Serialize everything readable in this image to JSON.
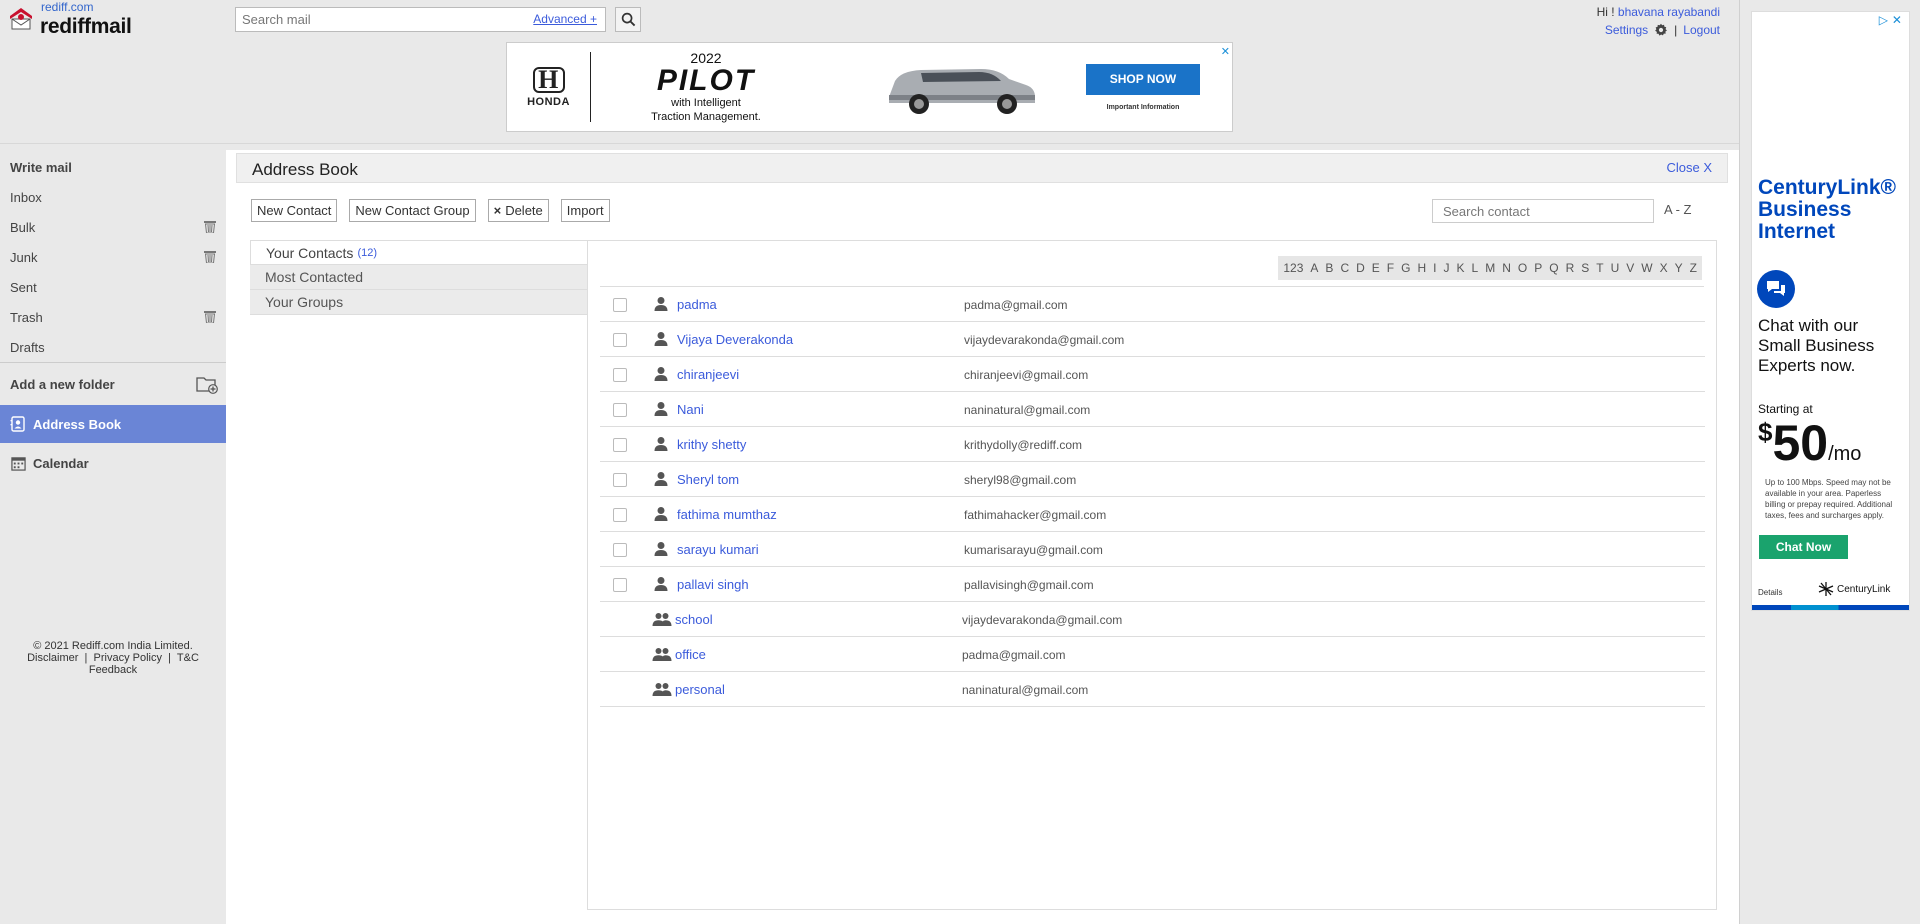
{
  "header": {
    "site_link": "rediff.com",
    "logo_text": "rediffmail",
    "search_placeholder": "Search mail",
    "advanced_label": "Advanced +",
    "greeting": "Hi !",
    "user_name": "bhavana rayabandi",
    "settings_label": "Settings",
    "logout_label": "Logout"
  },
  "ad_banner": {
    "brand": "HONDA",
    "year": "2022",
    "model": "PILOT",
    "tagline_1": "with Intelligent",
    "tagline_2": "Traction Management.",
    "cta": "SHOP NOW",
    "info": "Important Information"
  },
  "side_ad": {
    "brand_line_1": "CenturyLink®",
    "brand_line_2": "Business",
    "brand_line_3": "Internet",
    "chat_text": "Chat with our Small Business Experts now.",
    "starting": "Starting at",
    "dollar": "$",
    "price": "50",
    "per": "/mo",
    "fine_print": "Up to 100 Mbps. Speed may not be available in your area. Paperless billing or prepay required. Additional taxes, fees and surcharges apply.",
    "cta": "Chat Now",
    "details": "Details",
    "logo_text": "CenturyLink"
  },
  "sidebar": {
    "write_mail": "Write mail",
    "inbox": "Inbox",
    "bulk": "Bulk",
    "junk": "Junk",
    "sent": "Sent",
    "trash": "Trash",
    "drafts": "Drafts",
    "add_folder": "Add a new folder",
    "address_book": "Address Book",
    "calendar": "Calendar",
    "footer_copyright": "© 2021 Rediff.com India Limited.",
    "footer_disclaimer": "Disclaimer",
    "footer_privacy": "Privacy Policy",
    "footer_tc": "T&C",
    "footer_feedback": "Feedback",
    "separator": "|"
  },
  "address_book": {
    "title": "Address Book",
    "close": "Close X",
    "toolbar": {
      "new_contact": "New Contact",
      "new_group": "New Contact Group",
      "delete": "Delete",
      "delete_icon": "×",
      "import": "Import"
    },
    "search_placeholder": "Search contact",
    "sort_label": "A - Z",
    "tabs": {
      "your_contacts": "Your Contacts",
      "count": "(12)",
      "most_contacted": "Most Contacted",
      "your_groups": "Your Groups"
    },
    "alphabet": [
      "123",
      "A",
      "B",
      "C",
      "D",
      "E",
      "F",
      "G",
      "H",
      "I",
      "J",
      "K",
      "L",
      "M",
      "N",
      "O",
      "P",
      "Q",
      "R",
      "S",
      "T",
      "U",
      "V",
      "W",
      "X",
      "Y",
      "Z"
    ],
    "contacts": [
      {
        "name": "padma",
        "email": "padma@gmail.com"
      },
      {
        "name": "Vijaya Deverakonda",
        "email": "vijaydevarakonda@gmail.com"
      },
      {
        "name": "chiranjeevi",
        "email": "chiranjeevi@gmail.com"
      },
      {
        "name": "Nani",
        "email": "naninatural@gmail.com"
      },
      {
        "name": "krithy shetty",
        "email": "krithydolly@rediff.com"
      },
      {
        "name": "Sheryl tom",
        "email": "sheryl98@gmail.com"
      },
      {
        "name": "fathima mumthaz",
        "email": "fathimahacker@gmail.com"
      },
      {
        "name": "sarayu kumari",
        "email": "kumarisarayu@gmail.com"
      },
      {
        "name": "pallavi singh",
        "email": "pallavisingh@gmail.com"
      }
    ],
    "groups": [
      {
        "name": "school",
        "email": "vijaydevarakonda@gmail.com"
      },
      {
        "name": "office",
        "email": "padma@gmail.com"
      },
      {
        "name": "personal",
        "email": "naninatural@gmail.com"
      }
    ]
  },
  "colors": {
    "accent": "#6a85d6",
    "link": "#3b5bdb",
    "ad_blue": "#0047bb",
    "ad_green": "#1aa36d"
  }
}
